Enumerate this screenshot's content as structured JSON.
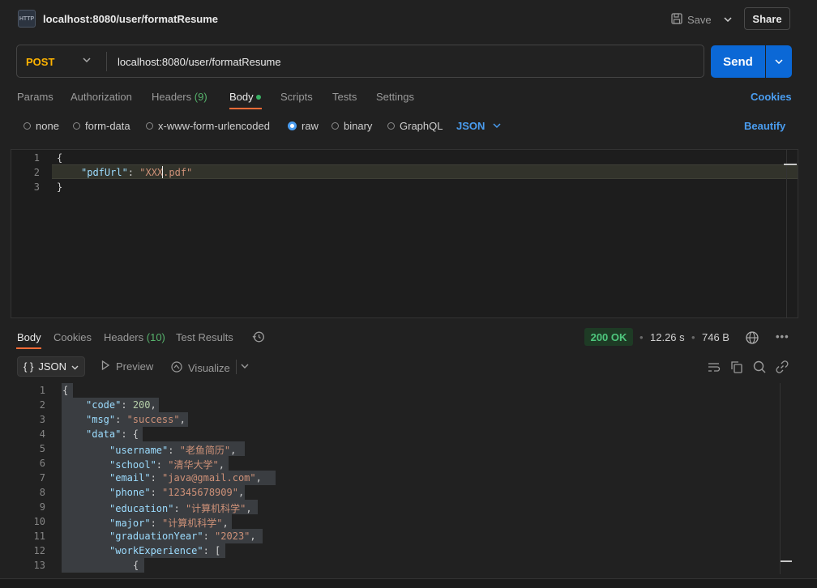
{
  "request": {
    "title": "localhost:8080/user/formatResume",
    "method": "POST",
    "url": "localhost:8080/user/formatResume",
    "save_label": "Save",
    "share_label": "Share",
    "send_label": "Send"
  },
  "request_tabs": {
    "params": "Params",
    "authorization": "Authorization",
    "headers": "Headers",
    "headers_count": "(9)",
    "body": "Body",
    "scripts": "Scripts",
    "tests": "Tests",
    "settings": "Settings",
    "cookies": "Cookies"
  },
  "body_types": {
    "none": "none",
    "form_data": "form-data",
    "urlencoded": "x-www-form-urlencoded",
    "raw": "raw",
    "binary": "binary",
    "graphql": "GraphQL",
    "language": "JSON",
    "beautify": "Beautify",
    "selected": "raw"
  },
  "editor": {
    "line_numbers": [
      "1",
      "2",
      "3"
    ],
    "open_brace": "{",
    "key": "\"pdfUrl\"",
    "colon": ": ",
    "value": "\"XXX.pdf\"",
    "close_brace": "}"
  },
  "response_tabs": {
    "body": "Body",
    "cookies": "Cookies",
    "headers": "Headers",
    "headers_count": "(10)",
    "test_results": "Test Results"
  },
  "response_meta": {
    "status": "200 OK",
    "time": "12.26 s",
    "size": "746 B"
  },
  "response_toolbar": {
    "format": "JSON",
    "format_icon": "{ }",
    "preview": "Preview",
    "visualize": "Visualize"
  },
  "response_body": {
    "line_numbers": [
      "1",
      "2",
      "3",
      "4",
      "5",
      "6",
      "7",
      "8",
      "9",
      "10",
      "11",
      "12",
      "13"
    ],
    "open_brace": "{",
    "code_key": "\"code\"",
    "code_val": "200",
    "msg_key": "\"msg\"",
    "msg_val": "\"success\"",
    "data_key": "\"data\"",
    "username_key": "\"username\"",
    "username_val": "\"老鱼简历\"",
    "school_key": "\"school\"",
    "school_val": "\"清华大学\"",
    "email_key": "\"email\"",
    "email_val": "\"java@gmail.com\"",
    "phone_key": "\"phone\"",
    "phone_val": "\"12345678909\"",
    "education_key": "\"education\"",
    "education_val": "\"计算机科学\"",
    "major_key": "\"major\"",
    "major_val": "\"计算机科学\"",
    "grad_key": "\"graduationYear\"",
    "grad_val": "\"2023\"",
    "work_key": "\"workExperience\"",
    "nested_brace": "{"
  },
  "colors": {
    "accent": "#ff6c37",
    "primary": "#0b68d6",
    "link": "#4a9df0",
    "method": "#ffb400",
    "success": "#4ec77d"
  }
}
